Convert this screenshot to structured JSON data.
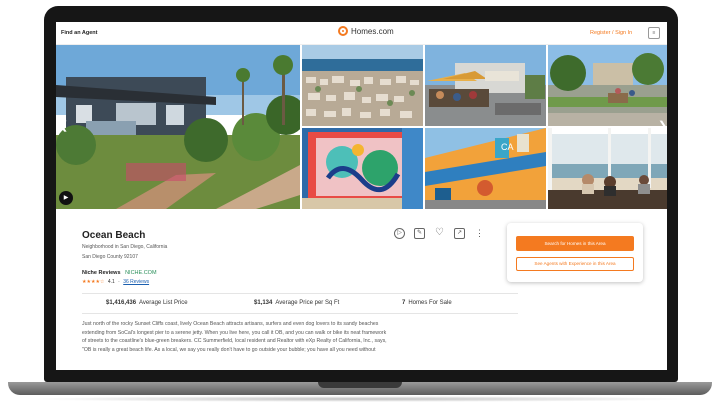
{
  "header": {
    "find_agent": "Find an Agent",
    "logo_text": "Homes.com",
    "register_signin": "Register / Sign In"
  },
  "gallery": {
    "prev_icon": "chevron-left-icon",
    "next_icon": "chevron-right-icon",
    "play_icon": "play-icon"
  },
  "place": {
    "title": "Ocean Beach",
    "neighborhood": "Neighborhood in San Diego, California",
    "county": "San Diego County 92107",
    "niche_label": "Niche Reviews",
    "niche_badge": "NICHE.COM",
    "stars": "★★★★☆",
    "rating": "4.1",
    "reviews": "36 Reviews"
  },
  "actions": {
    "play": "▷",
    "edit": "✎",
    "heart": "♡",
    "share": "↗",
    "more": "⋮"
  },
  "stats": {
    "avg_list_price_value": "$1,416,436",
    "avg_list_price_label": "Average List Price",
    "avg_price_sqft_value": "$1,134",
    "avg_price_sqft_label": "Average Price per Sq Ft",
    "homes_for_sale_value": "7",
    "homes_for_sale_label": "Homes For Sale"
  },
  "description": [
    "Just north of the rocky Sunset Cliffs coast, lively Ocean Beach attracts artisans, surfers and even dog lovers to its sandy beaches",
    "extending from SoCal's longest pier to a serene jetty. When you live here, you call it OB, and you can walk or bike its neat framework",
    "of streets to the coastline's blue-green breakers. CC Summerfield, local resident and Realtor with eXp Realty of California, Inc., says,",
    "\"OB is really a great beach life. As a local, we say you really don't have to go outside your bubble; you have all you need without"
  ],
  "cta": {
    "search_button": "Search for Homes in this Area",
    "agents_button": "See Agents with Experience in this Area"
  }
}
